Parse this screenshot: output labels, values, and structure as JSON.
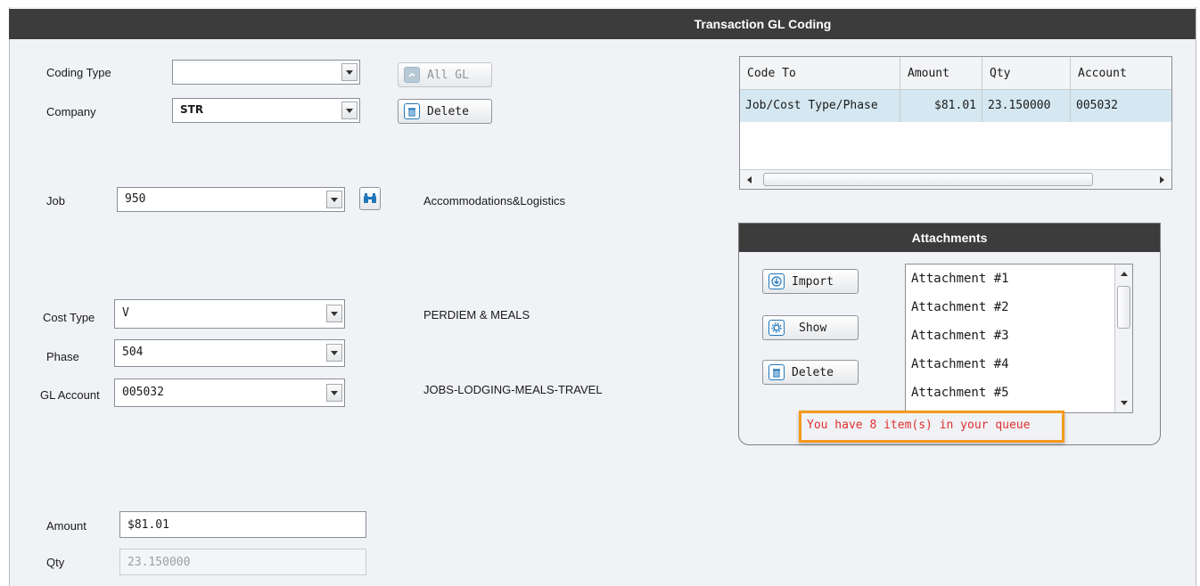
{
  "window": {
    "title": "Transaction GL Coding"
  },
  "form": {
    "coding_type": {
      "label": "Coding Type",
      "value": ""
    },
    "company": {
      "label": "Company",
      "value": "STR"
    },
    "all_gl_button": "All GL",
    "delete_button": "Delete",
    "job": {
      "label": "Job",
      "value": "950",
      "description": "Accommodations&Logistics"
    },
    "cost_type": {
      "label": "Cost Type",
      "value": "V",
      "description": "PERDIEM & MEALS"
    },
    "phase": {
      "label": "Phase",
      "value": "504"
    },
    "gl_account": {
      "label": "GL Account",
      "value": "005032",
      "description": "JOBS-LODGING-MEALS-TRAVEL"
    },
    "amount": {
      "label": "Amount",
      "value": "$81.01"
    },
    "qty": {
      "label": "Qty",
      "value": "23.150000"
    }
  },
  "coding_grid": {
    "columns": [
      "Code To",
      "Amount",
      "Qty",
      "Account"
    ],
    "rows": [
      {
        "code_to": "Job/Cost Type/Phase",
        "amount": "$81.01",
        "qty": "23.150000",
        "account": "005032"
      }
    ]
  },
  "attachments": {
    "title": "Attachments",
    "import_button": "Import",
    "show_button": "Show",
    "delete_button": "Delete",
    "items": [
      "Attachment #1",
      "Attachment #2",
      "Attachment #3",
      "Attachment #4",
      "Attachment #5"
    ],
    "queue_message": "You have 8 item(s) in your queue"
  },
  "colors": {
    "accent": "#2277bb",
    "header_bg": "#3c3c3c",
    "selected_row": "#d5e8f1",
    "queue_text": "#e03030",
    "highlight_border": "#f39a1e"
  }
}
